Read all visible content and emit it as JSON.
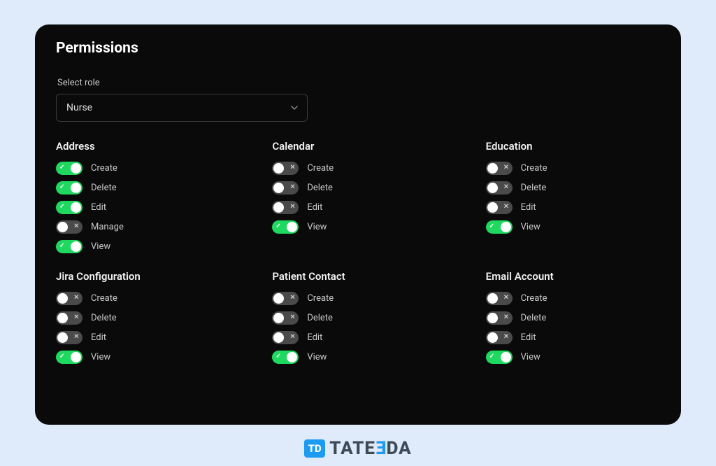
{
  "panel": {
    "title": "Permissions",
    "select_label": "Select role",
    "role_value": "Nurse"
  },
  "groups": [
    {
      "title": "Address",
      "permissions": [
        {
          "label": "Create",
          "enabled": true
        },
        {
          "label": "Delete",
          "enabled": true
        },
        {
          "label": "Edit",
          "enabled": true
        },
        {
          "label": "Manage",
          "enabled": false
        },
        {
          "label": "View",
          "enabled": true
        }
      ]
    },
    {
      "title": "Calendar",
      "permissions": [
        {
          "label": "Create",
          "enabled": false
        },
        {
          "label": "Delete",
          "enabled": false
        },
        {
          "label": "Edit",
          "enabled": false
        },
        {
          "label": "View",
          "enabled": true
        }
      ]
    },
    {
      "title": "Education",
      "permissions": [
        {
          "label": "Create",
          "enabled": false
        },
        {
          "label": "Delete",
          "enabled": false
        },
        {
          "label": "Edit",
          "enabled": false
        },
        {
          "label": "View",
          "enabled": true
        }
      ]
    },
    {
      "title": "Jira Configuration",
      "permissions": [
        {
          "label": "Create",
          "enabled": false
        },
        {
          "label": "Delete",
          "enabled": false
        },
        {
          "label": "Edit",
          "enabled": false
        },
        {
          "label": "View",
          "enabled": true
        }
      ]
    },
    {
      "title": "Patient Contact",
      "permissions": [
        {
          "label": "Create",
          "enabled": false
        },
        {
          "label": "Delete",
          "enabled": false
        },
        {
          "label": "Edit",
          "enabled": false
        },
        {
          "label": "View",
          "enabled": true
        }
      ]
    },
    {
      "title": "Email Account",
      "permissions": [
        {
          "label": "Create",
          "enabled": false
        },
        {
          "label": "Delete",
          "enabled": false
        },
        {
          "label": "Edit",
          "enabled": false
        },
        {
          "label": "View",
          "enabled": true
        }
      ]
    }
  ],
  "icons": {
    "check": "✓",
    "cross": "✕"
  },
  "brand": {
    "mark": "TD",
    "name": "TATEEDA"
  }
}
